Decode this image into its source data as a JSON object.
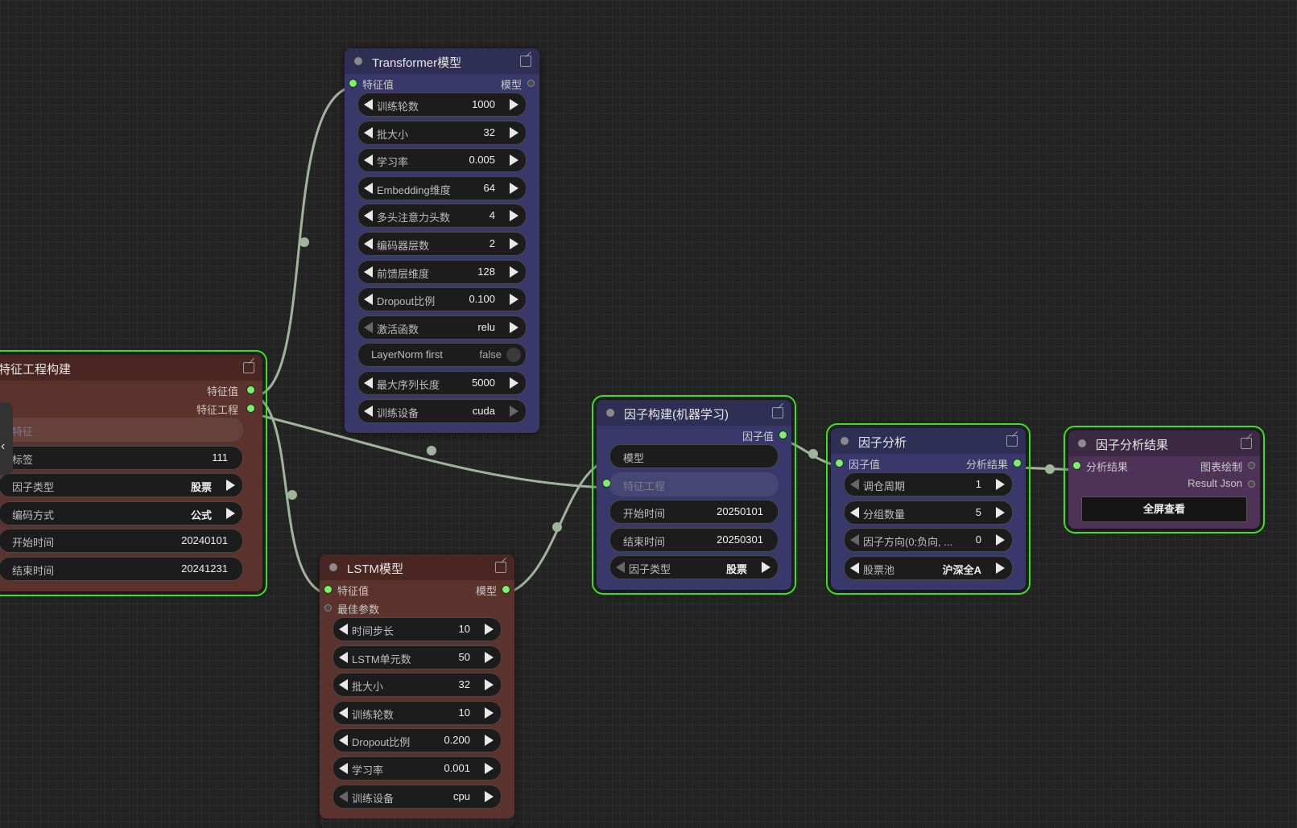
{
  "nodes": {
    "transformer": {
      "title": "Transformer模型",
      "input": "特征值",
      "output": "模型",
      "widgets": [
        {
          "label": "训练轮数",
          "value": "1000"
        },
        {
          "label": "批大小",
          "value": "32"
        },
        {
          "label": "学习率",
          "value": "0.005"
        },
        {
          "label": "Embedding维度",
          "value": "64"
        },
        {
          "label": "多头注意力头数",
          "value": "4"
        },
        {
          "label": "编码器层数",
          "value": "2"
        },
        {
          "label": "前馈层维度",
          "value": "128"
        },
        {
          "label": "Dropout比例",
          "value": "0.100"
        },
        {
          "label": "激活函数",
          "value": "relu"
        },
        {
          "label": "LayerNorm first",
          "value": "false"
        },
        {
          "label": "最大序列长度",
          "value": "5000"
        },
        {
          "label": "训练设备",
          "value": "cuda"
        }
      ]
    },
    "feature": {
      "title": "特征工程构建",
      "outputs": [
        "特征值",
        "特征工程"
      ],
      "widgets": [
        {
          "label": "特征",
          "value": ""
        },
        {
          "label": "标签",
          "value": "111"
        },
        {
          "label": "因子类型",
          "value": "股票"
        },
        {
          "label": "编码方式",
          "value": "公式"
        },
        {
          "label": "开始时间",
          "value": "20240101"
        },
        {
          "label": "结束时间",
          "value": "20241231"
        }
      ]
    },
    "lstm": {
      "title": "LSTM模型",
      "inputs": [
        "特征值",
        "最佳参数"
      ],
      "output": "模型",
      "widgets": [
        {
          "label": "时间步长",
          "value": "10"
        },
        {
          "label": "LSTM单元数",
          "value": "50"
        },
        {
          "label": "批大小",
          "value": "32"
        },
        {
          "label": "训练轮数",
          "value": "10"
        },
        {
          "label": "Dropout比例",
          "value": "0.200"
        },
        {
          "label": "学习率",
          "value": "0.001"
        },
        {
          "label": "训练设备",
          "value": "cpu"
        }
      ]
    },
    "factor_ml": {
      "title": "因子构建(机器学习)",
      "output": "因子值",
      "widgets": [
        {
          "label": "模型",
          "value": ""
        },
        {
          "label": "特征工程",
          "value": ""
        },
        {
          "label": "开始时间",
          "value": "20250101"
        },
        {
          "label": "结束时间",
          "value": "20250301"
        },
        {
          "label": "因子类型",
          "value": "股票"
        }
      ]
    },
    "factor_analysis": {
      "title": "因子分析",
      "input": "因子值",
      "output": "分析结果",
      "widgets": [
        {
          "label": "调仓周期",
          "value": "1"
        },
        {
          "label": "分组数量",
          "value": "5"
        },
        {
          "label": "因子方向(0:负向, ...",
          "value": "0"
        },
        {
          "label": "股票池",
          "value": "沪深全A"
        }
      ]
    },
    "analysis_result": {
      "title": "因子分析结果",
      "input": "分析结果",
      "outputs": [
        "图表绘制",
        "Result Json"
      ],
      "button": "全屏查看"
    }
  },
  "colors": {
    "selection": "#39e21c",
    "link": "#9fb59a",
    "socket_on": "#7af06c",
    "purple_body": "#38386a",
    "brown_body": "#5b322c",
    "magenta_body": "#4f3258"
  }
}
